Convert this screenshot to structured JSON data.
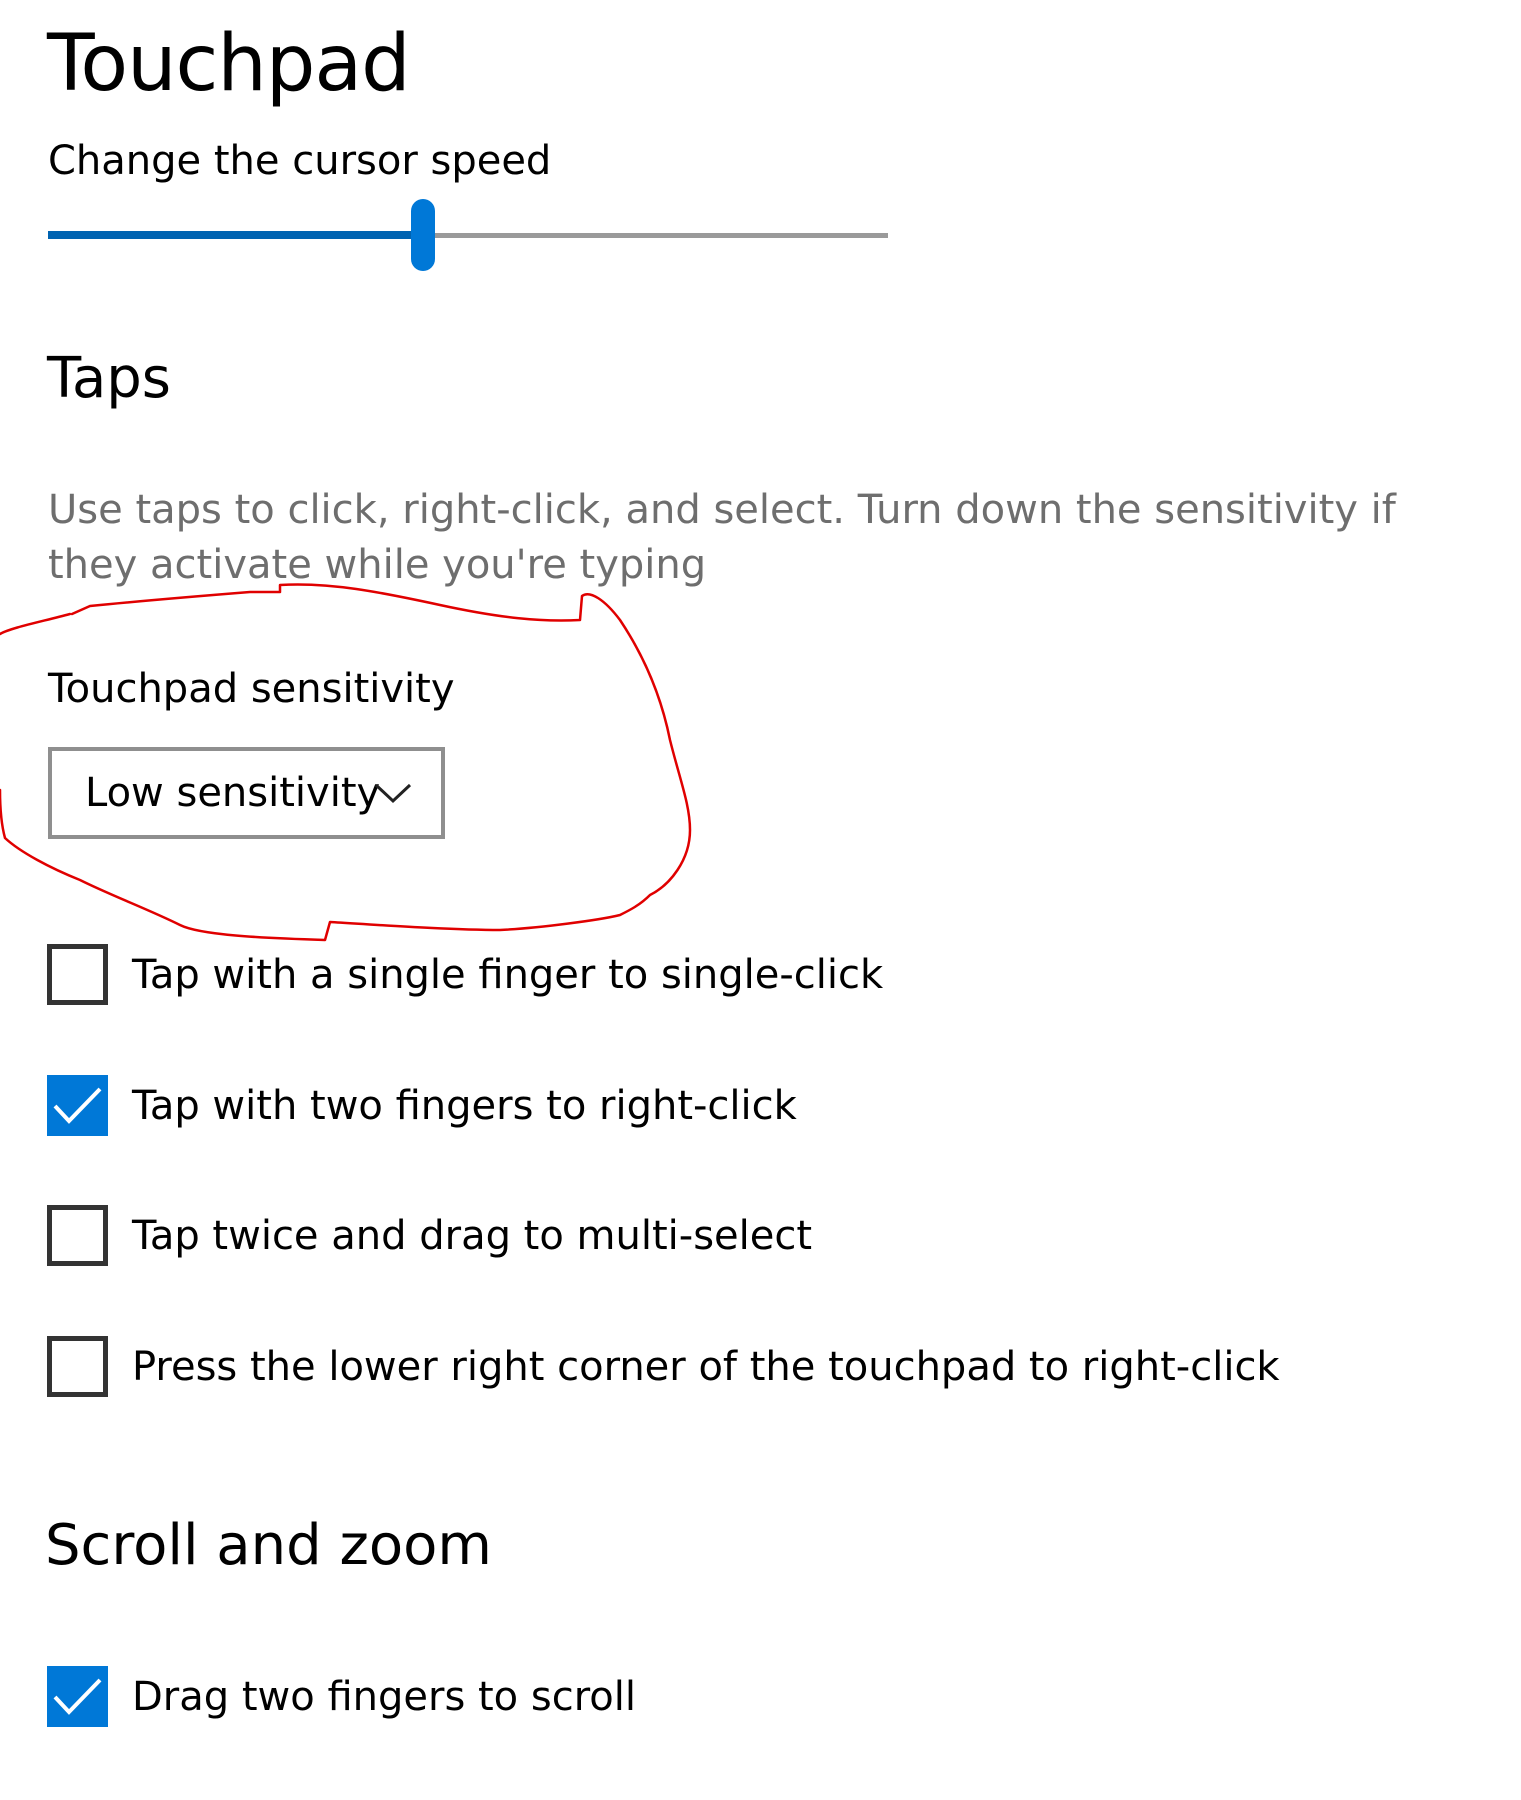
{
  "page": {
    "title": "Touchpad"
  },
  "cursor_speed": {
    "label": "Change the cursor speed",
    "value_fraction": 0.447
  },
  "taps": {
    "heading": "Taps",
    "description": "Use taps to click, right-click, and select. Turn down the sensitivity if they activate while you're typing",
    "sensitivity": {
      "label": "Touchpad sensitivity",
      "selected": "Low sensitivity"
    },
    "options": [
      {
        "label": "Tap with a single finger to single-click",
        "checked": false
      },
      {
        "label": "Tap with two fingers to right-click",
        "checked": true
      },
      {
        "label": "Tap twice and drag to multi-select",
        "checked": false
      },
      {
        "label": "Press the lower right corner of the touchpad to right-click",
        "checked": false
      }
    ]
  },
  "scroll_zoom": {
    "heading": "Scroll and zoom",
    "options": [
      {
        "label": "Drag two fingers to scroll",
        "checked": true
      }
    ]
  },
  "colors": {
    "accent": "#0078d7",
    "annotation": "#e00000"
  },
  "icons": {
    "dropdown": "chevron-down-icon",
    "checked": "checkmark-icon"
  }
}
